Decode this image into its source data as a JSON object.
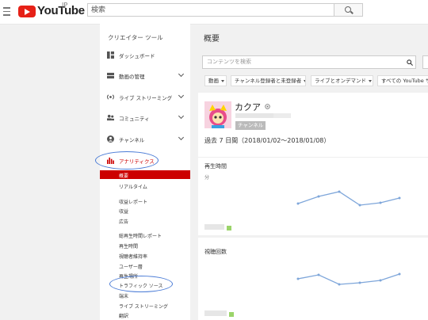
{
  "header": {
    "logo_text": "YouTube",
    "logo_sup": "JP",
    "search_placeholder": "検索"
  },
  "sidebar": {
    "title": "クリエイター ツール",
    "items": [
      {
        "label": "ダッシュボード",
        "icon": "dashboard-icon"
      },
      {
        "label": "動画の管理",
        "icon": "video-manager-icon"
      },
      {
        "label": "ライブ ストリーミング",
        "icon": "live-icon"
      },
      {
        "label": "コミュニティ",
        "icon": "community-icon"
      },
      {
        "label": "チャンネル",
        "icon": "channel-icon"
      },
      {
        "label": "アナリティクス",
        "icon": "analytics-icon"
      }
    ],
    "subitems": [
      "概要",
      "リアルタイム",
      "収益レポート",
      "収益",
      "広告",
      "総再生時間レポート",
      "再生時間",
      "視聴者維持率",
      "ユーザー層",
      "再生場所",
      "トラフィック ソース",
      "端末",
      "ライブ ストリーミング",
      "翻訳"
    ],
    "active_subitem": "概要",
    "accent_color": "#cc0000",
    "annotation_color": "#4a7bd6"
  },
  "main": {
    "title": "概要",
    "content_search_placeholder": "コンテンツを検索",
    "filters": [
      "動画",
      "チャンネル登録者と未登録者",
      "ライブとオンデマンド",
      "すべての YouTube サービス"
    ],
    "channel": {
      "name": "カクア",
      "badge": "チャンネル",
      "date_range": "過去 7 日間（2018/01/02〜2018/01/08）"
    },
    "metrics": [
      {
        "label": "再生時間",
        "unit": "分"
      },
      {
        "label": "視聴回数"
      }
    ]
  }
}
